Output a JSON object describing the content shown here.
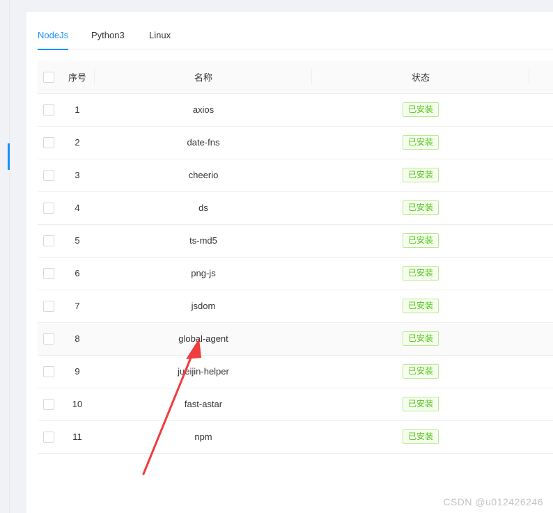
{
  "tabs": [
    {
      "label": "NodeJs",
      "active": true
    },
    {
      "label": "Python3",
      "active": false
    },
    {
      "label": "Linux",
      "active": false
    }
  ],
  "table": {
    "headers": {
      "index": "序号",
      "name": "名称",
      "status": "状态"
    },
    "rows": [
      {
        "index": "1",
        "name": "axios",
        "status": "已安装"
      },
      {
        "index": "2",
        "name": "date-fns",
        "status": "已安装"
      },
      {
        "index": "3",
        "name": "cheerio",
        "status": "已安装"
      },
      {
        "index": "4",
        "name": "ds",
        "status": "已安装"
      },
      {
        "index": "5",
        "name": "ts-md5",
        "status": "已安装"
      },
      {
        "index": "6",
        "name": "png-js",
        "status": "已安装"
      },
      {
        "index": "7",
        "name": "jsdom",
        "status": "已安装"
      },
      {
        "index": "8",
        "name": "global-agent",
        "status": "已安装"
      },
      {
        "index": "9",
        "name": "jueijin-helper",
        "status": "已安装"
      },
      {
        "index": "10",
        "name": "fast-astar",
        "status": "已安装"
      },
      {
        "index": "11",
        "name": "npm",
        "status": "已安装"
      }
    ]
  },
  "watermark": "CSDN @u012426246",
  "colors": {
    "accent": "#1890ff",
    "success": "#52c41a",
    "annotation_arrow": "#f03c3c"
  }
}
